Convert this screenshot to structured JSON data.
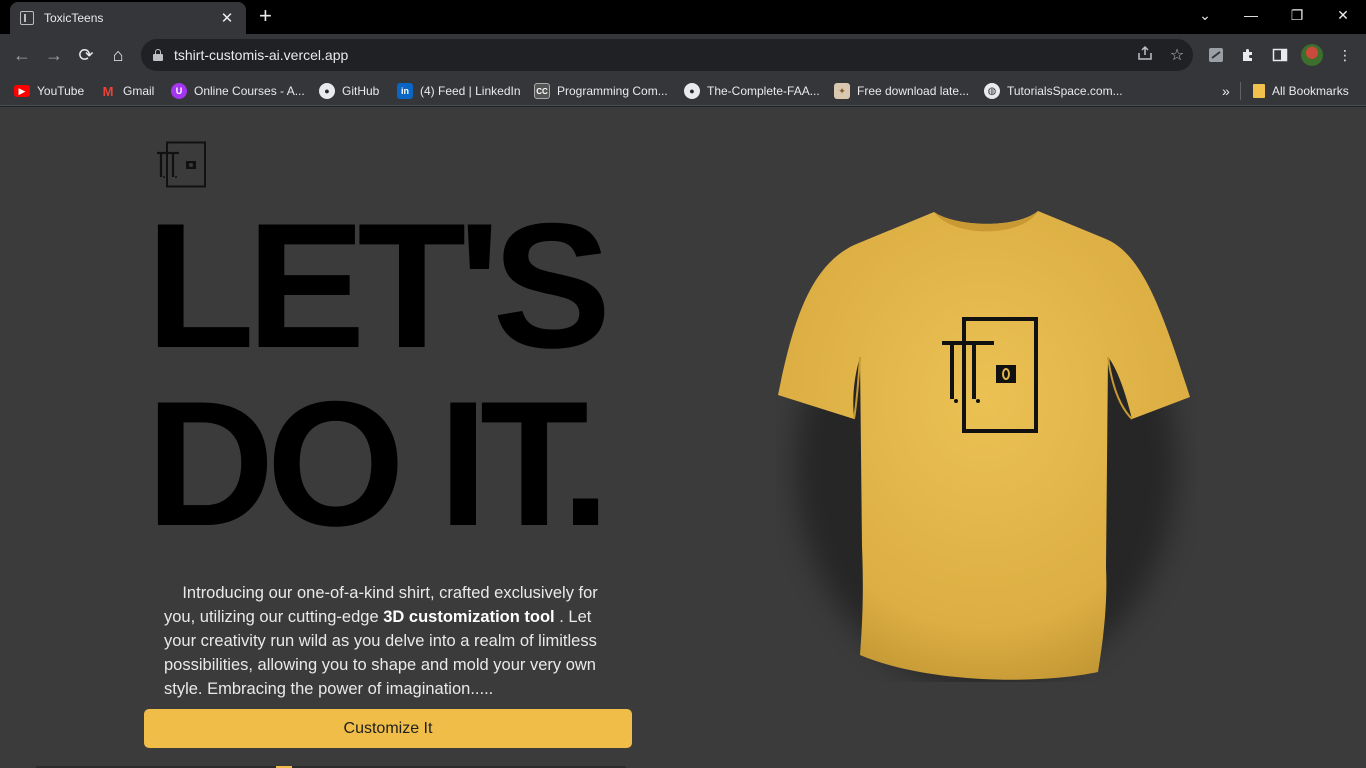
{
  "browser": {
    "tab_title": "ToxicTeens",
    "tab_close": "✕",
    "new_tab": "+",
    "url": "tshirt-customis-ai.vercel.app",
    "window_controls": {
      "minimize": "—",
      "restore": "❐",
      "close": "✕",
      "tablist": "⌄"
    },
    "nav": {
      "back": "←",
      "forward": "→",
      "reload": "⟳",
      "home": "⌂"
    },
    "bookmarks": [
      {
        "label": "YouTube",
        "icon": "youtube-icon",
        "color": "#ff0000"
      },
      {
        "label": "Gmail",
        "icon": "gmail-icon",
        "color": "#ea4335"
      },
      {
        "label": "Online Courses - A...",
        "icon": "courses-icon",
        "color": "#a435f0"
      },
      {
        "label": "GitHub",
        "icon": "github-icon",
        "color": "#ffffff"
      },
      {
        "label": "(4) Feed | LinkedIn",
        "icon": "linkedin-icon",
        "color": "#0a66c2"
      },
      {
        "label": "Programming Com...",
        "icon": "cc-icon",
        "color": "#555555"
      },
      {
        "label": "The-Complete-FAA...",
        "icon": "github-icon",
        "color": "#ffffff"
      },
      {
        "label": "Free download late...",
        "icon": "download-icon",
        "color": "#8b5a2b"
      },
      {
        "label": "TutorialsSpace.com...",
        "icon": "globe-icon",
        "color": "#e8eaed"
      }
    ],
    "bookmarks_overflow": "»",
    "all_bookmarks": "All Bookmarks"
  },
  "page": {
    "headline_line1": "LET'S",
    "headline_line2": "DO IT.",
    "intro_part1": "Introducing our one-of-a-kind shirt, crafted exclusively for you, utilizing our cutting-edge ",
    "intro_bold": "3D customization tool",
    "intro_part2": " . Let your creativity run wild as you delve into a realm of limitless possibilities, allowing you to shape and mold your very own style. Embracing the power of imagination.....",
    "cta_label": "Customize It",
    "shirt_color": "#e1b44a",
    "accent_color": "#efbd48",
    "background_color": "#3b3b3b"
  }
}
